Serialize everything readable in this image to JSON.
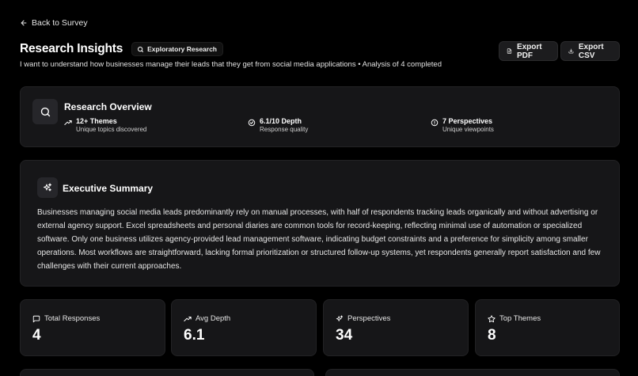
{
  "nav": {
    "back_label": "Back to Survey"
  },
  "header": {
    "title": "Research Insights",
    "badge": "Exploratory Research",
    "subtitle": "I want to understand how businesses manage their leads that they get from social media applications • Analysis of 4 completed",
    "export_pdf": "Export PDF",
    "export_csv": "Export CSV"
  },
  "overview": {
    "title": "Research Overview",
    "metrics": [
      {
        "value": "12+ Themes",
        "desc": "Unique topics discovered",
        "icon": "trending-up-icon"
      },
      {
        "value": "6.1/10 Depth",
        "desc": "Response quality",
        "icon": "check-circle-icon"
      },
      {
        "value": "7 Perspectives",
        "desc": "Unique viewpoints",
        "icon": "info-circle-icon"
      }
    ]
  },
  "summary": {
    "title": "Executive Summary",
    "body": "Businesses managing social media leads predominantly rely on manual processes, with half of respondents tracking leads organically and without advertising or external agency support. Excel spreadsheets and personal diaries are common tools for record-keeping, reflecting minimal use of automation or specialized software. Only one business utilizes agency-provided lead management software, indicating budget constraints and a preference for simplicity among smaller operations. Most workflows are straightforward, lacking formal prioritization or structured follow-up systems, yet respondents generally report satisfaction and few challenges with their current approaches."
  },
  "stats": [
    {
      "label": "Total Responses",
      "value": "4",
      "icon": "message-square-icon"
    },
    {
      "label": "Avg Depth",
      "value": "6.1",
      "icon": "trending-up-icon"
    },
    {
      "label": "Perspectives",
      "value": "34",
      "icon": "sparkles-icon"
    },
    {
      "label": "Top Themes",
      "value": "8",
      "icon": "star-icon"
    }
  ],
  "colors": {
    "background": "#000000",
    "card": "#161618",
    "text": "#ffffff"
  }
}
